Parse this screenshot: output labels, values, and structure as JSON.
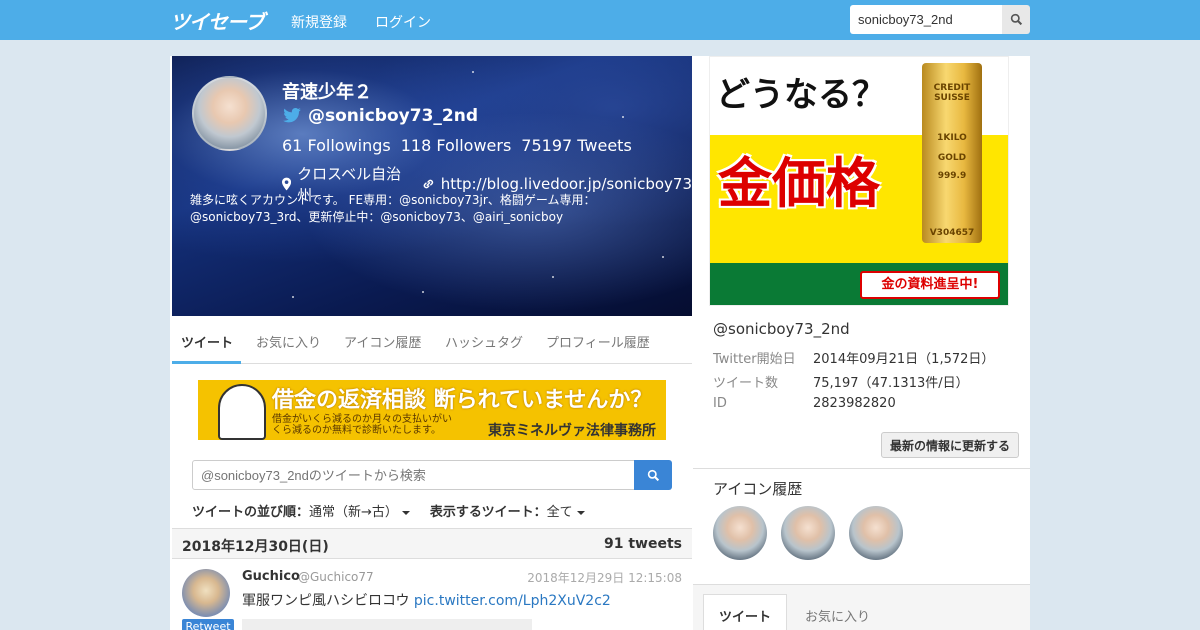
{
  "navbar": {
    "brand": "ツイセーブ",
    "signup": "新規登録",
    "login": "ログイン",
    "search_value": "sonicboy73_2nd"
  },
  "profile": {
    "name": "音速少年２",
    "handle": "@sonicboy73_2nd",
    "followings": "61 Followings",
    "followers": "118 Followers",
    "tweets": "75197 Tweets",
    "location": "クロスベル自治州",
    "url": "http://blog.livedoor.jp/sonicboy73",
    "bio": "雑多に呟くアカウントです。 FE専用：@sonicboy73jr、格闘ゲーム専用：@sonicboy73_3rd、更新停止中：@sonicboy73、@airi_sonicboy"
  },
  "tabs": {
    "items": [
      {
        "label": "ツイート"
      },
      {
        "label": "お気に入り"
      },
      {
        "label": "アイコン履歴"
      },
      {
        "label": "ハッシュタグ"
      },
      {
        "label": "プロフィール履歴"
      }
    ]
  },
  "ad_left": {
    "headline": "借金の返済相談 断られていませんか？",
    "sub": "借金がいくら減るのか月々の支払いがいくら減るのか無料で診断いたします。",
    "firm": "東京ミネルヴァ法律事務所"
  },
  "tweet_search": {
    "placeholder": "@sonicboy73_2ndのツイートから検索"
  },
  "sort": {
    "order_label": "ツイートの並び順：",
    "order_value": "通常（新→古）",
    "filter_label": "表示するツイート：",
    "filter_value": "全て"
  },
  "date_bar": {
    "date": "2018年12月30日(日)",
    "count": "91 tweets"
  },
  "tweet": {
    "user": "Guchico",
    "screen": "@Guchico77",
    "time": "2018年12月29日 12:15:08",
    "text": "軍服ワンピ風ハシビロコウ",
    "link": "pic.twitter.com/Lph2XuV2c2",
    "badge": "Retweet"
  },
  "ad_right": {
    "question": "どうなる？",
    "headline": "金価格",
    "bar_lines": [
      "CREDIT SUISSE",
      "1KILO",
      "GOLD",
      "999.9",
      "V304657"
    ],
    "cta": "金の資料進呈中!"
  },
  "account": {
    "handle": "@sonicboy73_2nd",
    "rows": [
      {
        "k": "Twitter開始日",
        "v": "2014年09月21日（1,572日）"
      },
      {
        "k": "ツイート数",
        "v": "75,197（47.1313件/日）"
      },
      {
        "k": "ID",
        "v": "2823982820"
      }
    ],
    "refresh": "最新の情報に更新する"
  },
  "icon_history": {
    "title": "アイコン履歴"
  },
  "bottom_tabs": {
    "items": [
      {
        "label": "ツイート"
      },
      {
        "label": "お気に入り"
      }
    ]
  }
}
